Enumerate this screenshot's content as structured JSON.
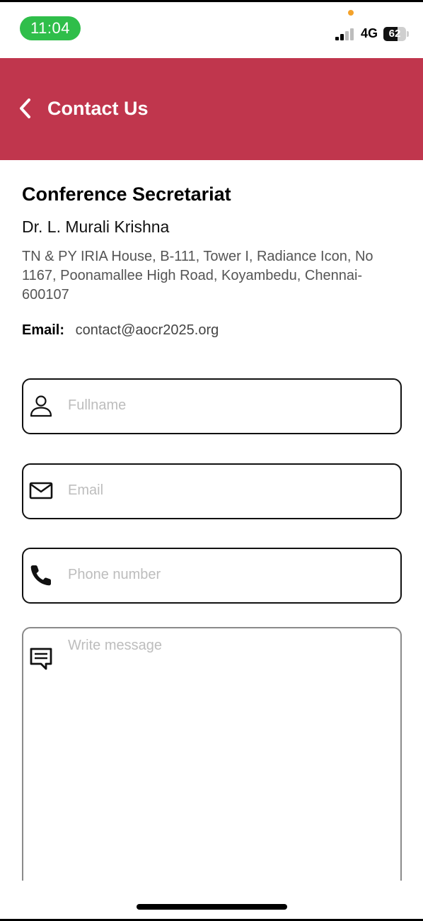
{
  "status_bar": {
    "time": "11:04",
    "network": "4G",
    "battery": "62",
    "battery_level": 0.62,
    "signal_bars": 2,
    "time_color": "#2fbe4a",
    "privacy_dot_color": "#f4a22a"
  },
  "header": {
    "title": "Contact Us",
    "back_icon": "chevron-left-icon",
    "background": "#c0364d"
  },
  "secretariat": {
    "title": "Conference Secretariat",
    "name": "Dr. L. Murali Krishna",
    "address": "TN & PY IRIA House, B-111, Tower I, Radiance Icon, No 1167, Poonamallee High Road, Koyambedu, Chennai-600107",
    "email_label": "Email:",
    "email": "contact@aocr2025.org"
  },
  "form": {
    "fullname": {
      "placeholder": "Fullname",
      "icon": "user-icon"
    },
    "email": {
      "placeholder": "Email",
      "icon": "mail-icon"
    },
    "phone": {
      "placeholder": "Phone number",
      "icon": "phone-icon"
    },
    "message": {
      "placeholder": "Write message",
      "icon": "message-icon"
    }
  }
}
